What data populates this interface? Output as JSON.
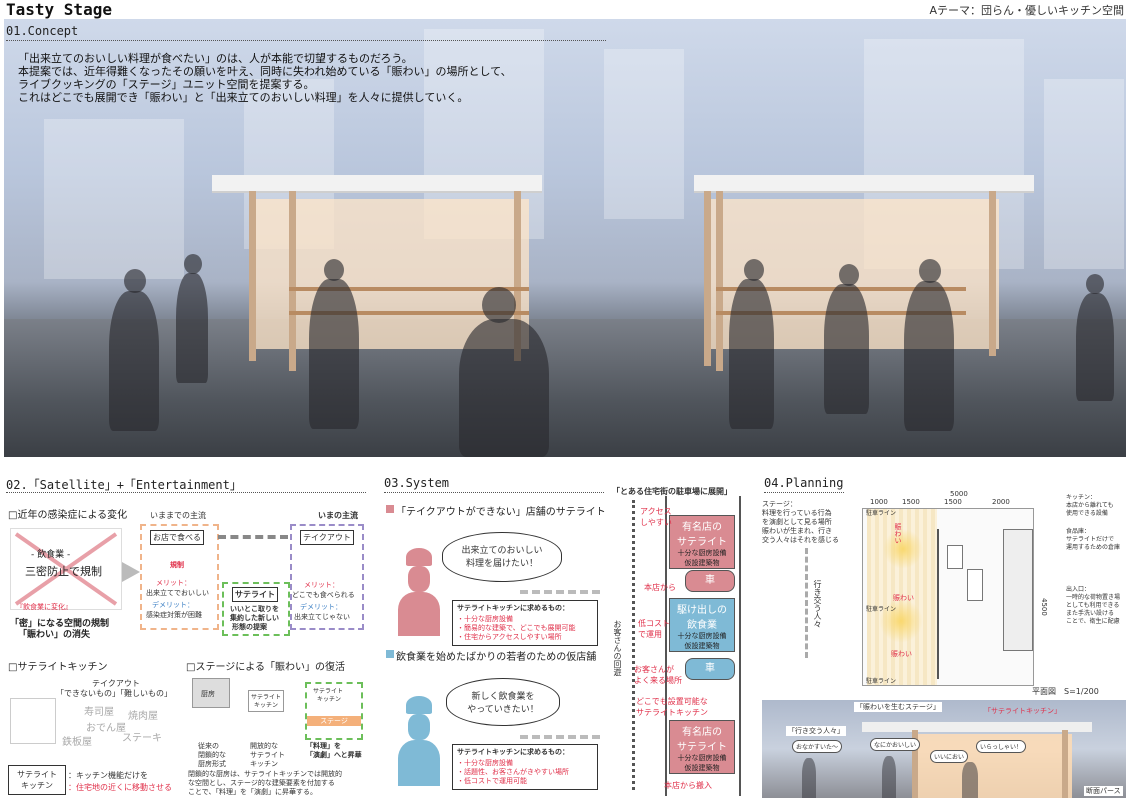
{
  "header": {
    "title": "Tasty Stage",
    "theme": "Aテーマ：団らん・優しいキッチン空間"
  },
  "concept": {
    "heading": "01.Concept",
    "lines": [
      "「出来立てのおいしい料理が食べたい」のは、人が本能で切望するものだろう。",
      "本提案では、近年得難くなったその願いを叶え、同時に失われ始めている「賑わい」の場所として、",
      "ライブクッキングの「ステージ」ユニット空間を提案する。",
      "これはどこでも展開でき「賑わい」と「出来立てのおいしい料理」を人々に提供していく。"
    ]
  },
  "satellite": {
    "heading": "02.「Satellite」+「Entertainment」",
    "sub1": "□近年の感染症による変化",
    "crossed": [
      "- 飲食業 -",
      "三密防止で規制"
    ],
    "change_note": "『飲食業に変化』",
    "result": "「密」になる空間の規制",
    "result2": "「賑わい」の消失",
    "old_label": "いままでの主流",
    "now_label": "いまの主流",
    "eat_in": "お店で食べる",
    "regulation": "規制",
    "merit_old": "メリット：",
    "merit_old_text": "出来立てでおいしい",
    "demerit_old": "デメリット：",
    "demerit_old_text": "感染症対策が困難",
    "satellite_label": "サテライト",
    "satellite_desc": [
      "いいとこ取りを",
      "集約した新しい",
      "形態の提案"
    ],
    "takeout": "テイクアウト",
    "merit_new": "メリット：",
    "merit_new_text": "どこでも食べられる",
    "demerit_new": "デメリット：",
    "demerit_new_text": "出来立てじゃない",
    "sub2": "□サテライトキッチン",
    "takeout2": "テイクアウト",
    "cannot": "「できないもの」「難しいもの」",
    "shops": [
      "寿司屋",
      "焼肉屋",
      "おでん屋",
      "鉄板屋",
      "ステーキ"
    ],
    "sk_label": [
      "サテライト",
      "キッチン"
    ],
    "sk_desc1": "：キッチン機能だけを",
    "sk_desc2": "：住宅地の近くに移動させる",
    "sub3": "□ステージによる「賑わい」の復活",
    "kitchen_old": "厨房",
    "sk_small": [
      "サテライト",
      "キッチン"
    ],
    "stage_word": "ステージ",
    "closed": [
      "従来の",
      "閉鎖的な",
      "厨房形式"
    ],
    "open": [
      "開放的な",
      "サテライト",
      "キッチン"
    ],
    "elevate": [
      "「料理」を",
      "「演劇」へと昇華"
    ],
    "footnote": [
      "閉鎖的な厨房は、サテライトキッチンでは開放的",
      "な空間とし、ステージ的な建築要素を付加する",
      "ことで、「料理」を「演劇」に昇華する。"
    ]
  },
  "system": {
    "heading": "03.System",
    "parking": "「とある住宅街の駐車場に展開」",
    "a_title": "「テイクアウトができない」店舗のサテライト",
    "a_bubble": [
      "出来立てのおいしい",
      "料理を届けたい！"
    ],
    "a_req_title": "サテライトキッチンに求めるもの：",
    "a_reqs": [
      "・十分な厨房設備",
      "・簡易的な建築で、どこでも展開可能",
      "・住宅からアクセスしやすい場所"
    ],
    "b_title": "飲食業を始めたばかりの若者のための仮店舗",
    "b_bubble": [
      "新しく飲食業を",
      "やっていきたい！"
    ],
    "b_req_title": "サテライトキッチンに求めるもの：",
    "b_reqs": [
      "・十分な厨房設備",
      "・話題性、お客さんがきやすい場所",
      "・低コストで運用可能"
    ],
    "famous1": [
      "有名店の",
      "サテライト"
    ],
    "famous1_sub": [
      "十分な厨房設備",
      "仮設建築物"
    ],
    "car1": "車",
    "starter": [
      "駆け出しの",
      "飲食業"
    ],
    "starter_sub": [
      "十分な厨房設備",
      "仮設建築物"
    ],
    "car2": "車",
    "famous2": [
      "有名店の",
      "サテライト"
    ],
    "famous2_sub": [
      "十分な厨房設備",
      "仮設建築物"
    ],
    "access": [
      "アクセス",
      "しやすい"
    ],
    "from_shop1": "本店から",
    "low_cost": [
      "低コスト",
      "で運用"
    ],
    "customers": [
      "お客さんが",
      "よく来る場所"
    ],
    "anywhere": [
      "どこでも設置可能な",
      "サテライトキッチン"
    ],
    "from_shop2": "本店から搬入",
    "flow": "お客さんの回遊"
  },
  "planning": {
    "heading": "04.Planning",
    "stage_note": [
      "ステージ：",
      "料理を行っている行為",
      "を演劇として見る場所",
      "賑わいが生まれ、行き",
      "交う人々はそれを感じる"
    ],
    "kitchen_note": [
      "キッチン：",
      "本店から離れても",
      "使用できる設備"
    ],
    "storage_note": [
      "食品庫：",
      "サテライトだけで",
      "運用するための倉庫"
    ],
    "exit_note": [
      "出入口：",
      "一時的な荷物置き場",
      "としても利用できる",
      "また手洗い設ける",
      "ことで、衛生に配慮"
    ],
    "dims_top": [
      "1000",
      "1500",
      "1500",
      "2000"
    ],
    "dim_total": "5000",
    "dim_side": "4500",
    "flow_label": "行き交う人々",
    "nigiwai": [
      "賑わい",
      "賑わい",
      "賑わい"
    ],
    "line_labels": [
      "駐車ライン",
      "駐車ライン",
      "駐車ライン"
    ],
    "plan_title": "平面図　S=1/200",
    "persp_labels": [
      "「賑わいを生むステージ」",
      "「サテライトキッチン」",
      "「行き交う人々」"
    ],
    "persp_bubbles": [
      "おなかすいた～",
      "なにかおいしい",
      "いいにおい",
      "いらっしゃい！"
    ],
    "persp_title": "断面パース"
  }
}
